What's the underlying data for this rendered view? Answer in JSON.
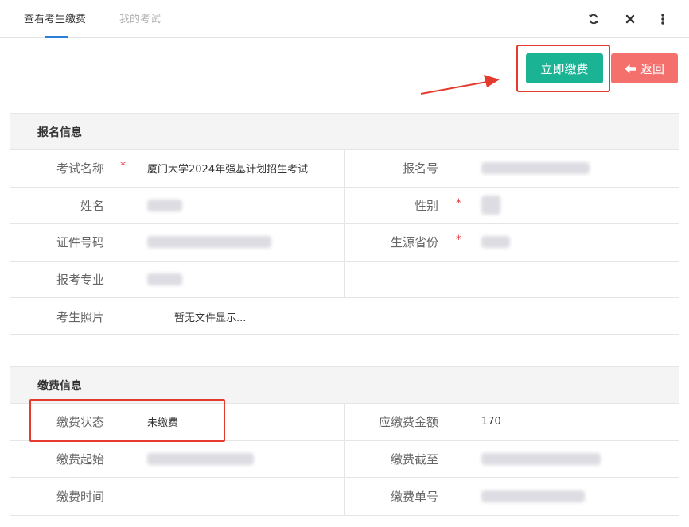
{
  "tabs": [
    {
      "label": "查看考生缴费"
    },
    {
      "label": "我的考试"
    }
  ],
  "actions": {
    "pay_label": "立即缴费",
    "back_label": "返回"
  },
  "registration": {
    "header": "报名信息",
    "exam_name_label": "考试名称",
    "exam_name_value": "厦门大学2024年强基计划招生考试",
    "reg_no_label": "报名号",
    "name_label": "姓名",
    "gender_label": "性别",
    "id_label": "证件号码",
    "province_label": "生源省份",
    "major_label": "报考专业",
    "photo_label": "考生照片",
    "photo_value": "暂无文件显示...",
    "required_mark": "*"
  },
  "payment": {
    "header": "缴费信息",
    "status_label": "缴费状态",
    "status_value": "未缴费",
    "amount_label": "应缴费金额",
    "amount_value": "170",
    "start_label": "缴费起始",
    "end_label": "缴费截至",
    "time_label": "缴费时间",
    "order_label": "缴费单号"
  },
  "colors": {
    "primary": "#1ab394",
    "danger": "#f3706d",
    "annotation": "#e53a2e",
    "tab_underline": "#2a7fd6"
  }
}
